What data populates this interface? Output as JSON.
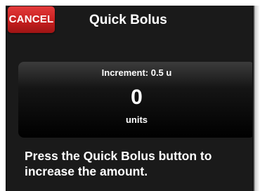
{
  "header": {
    "cancel_label": "CANCEL",
    "title": "Quick Bolus"
  },
  "bolus_panel": {
    "increment_text": "Increment: 0.5 u",
    "amount": "0",
    "unit_label": "units"
  },
  "instruction": {
    "line1": "Press the Quick Bolus button to",
    "line2": "increase the amount."
  },
  "colors": {
    "cancel_button": "#c81f1f",
    "screen_background": "#1a1a1a",
    "text": "#ffffff"
  }
}
